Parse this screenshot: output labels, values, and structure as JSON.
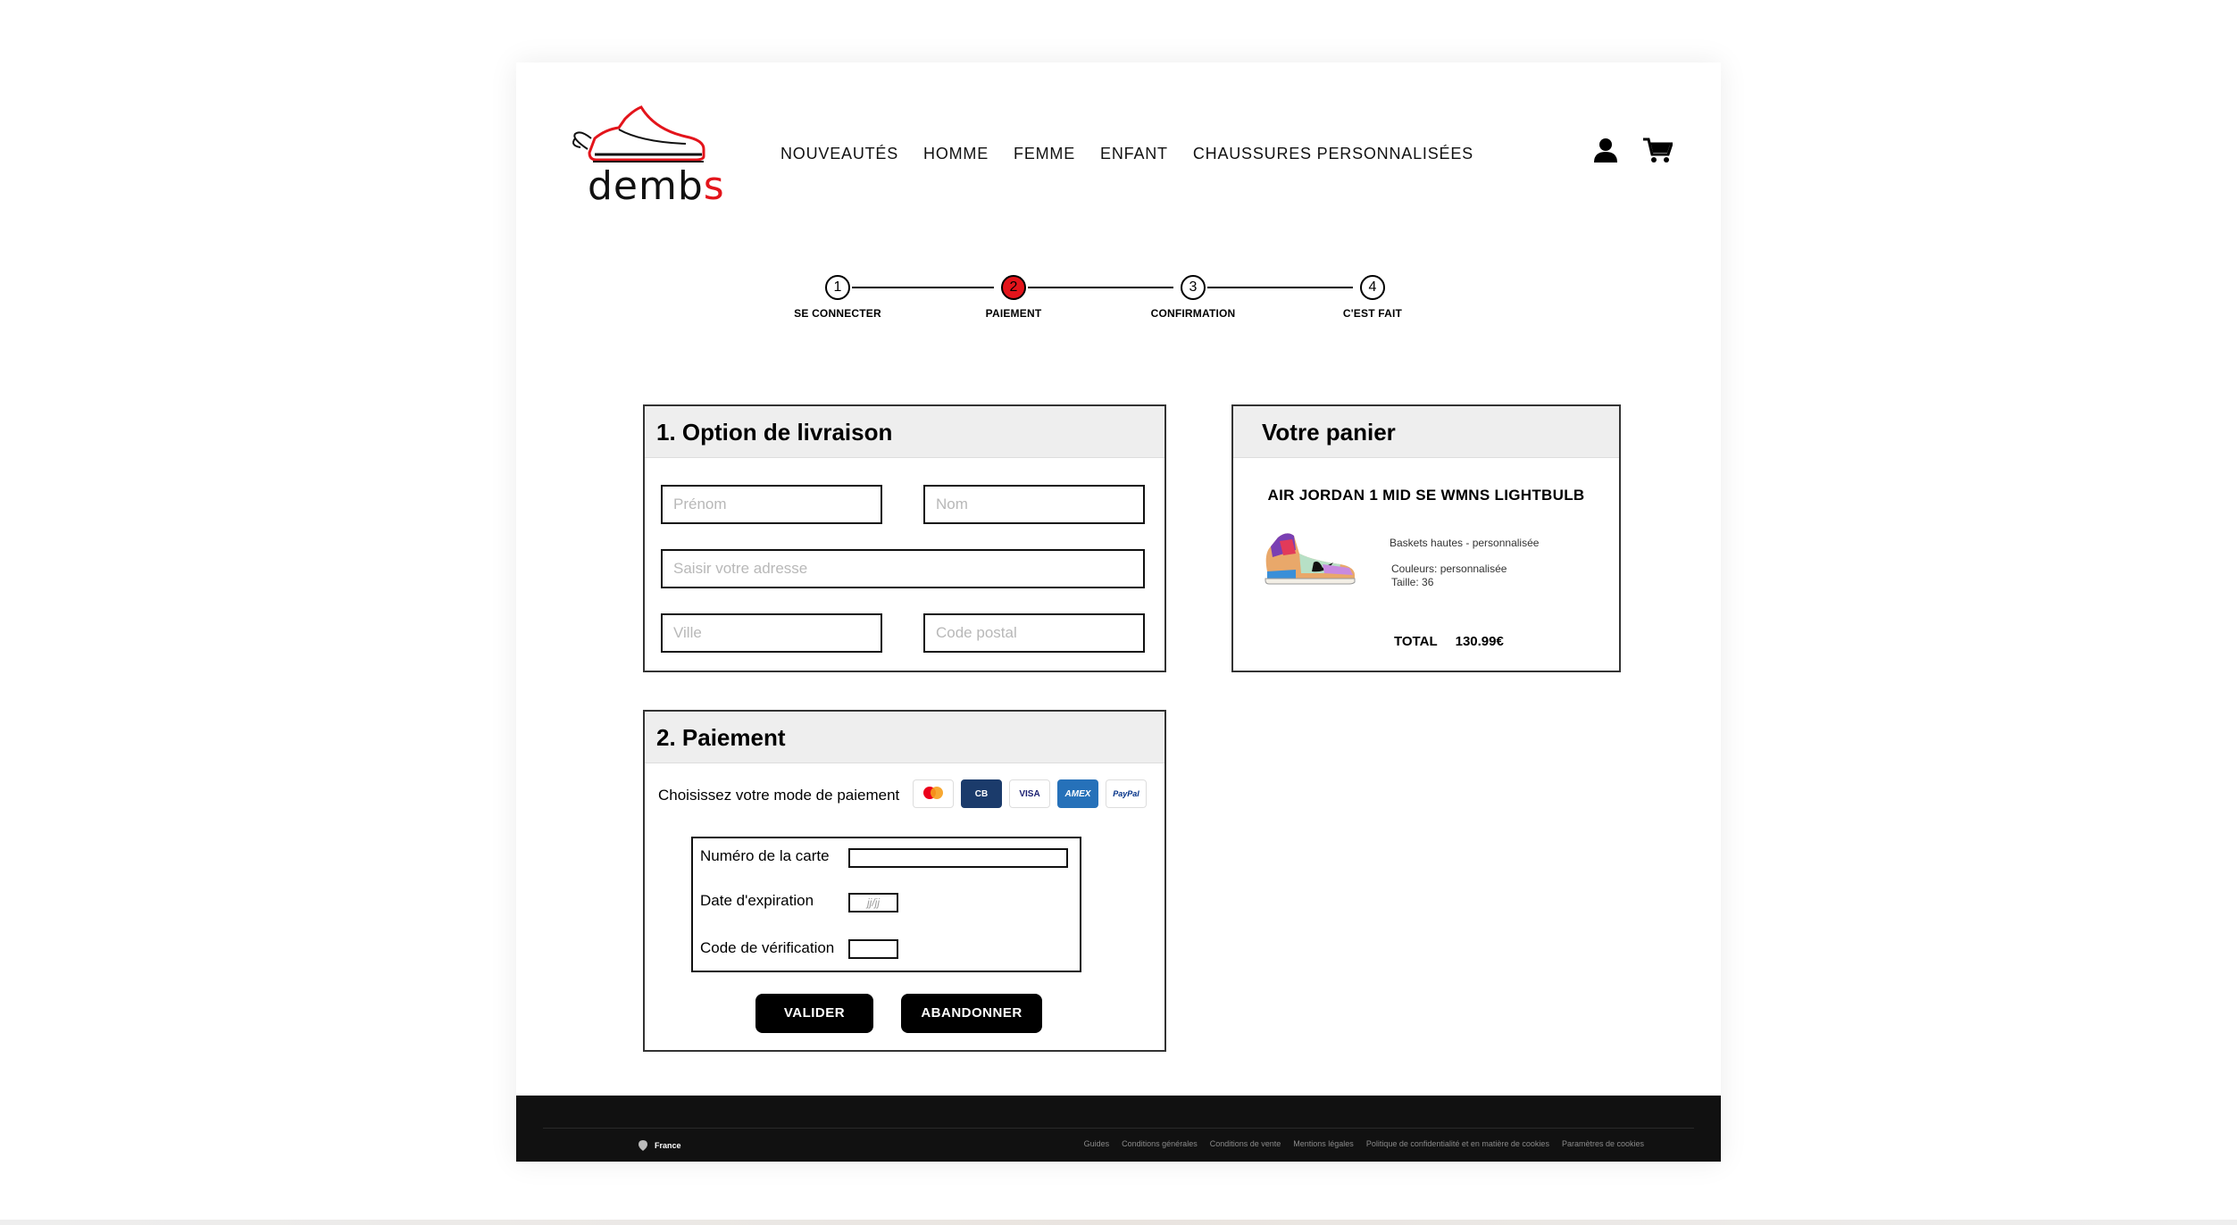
{
  "brand": {
    "logo_text_main": "demb",
    "logo_text_accent": "s"
  },
  "nav": {
    "items": [
      {
        "label": "NOUVEAUTÉS"
      },
      {
        "label": "HOMME"
      },
      {
        "label": "FEMME"
      },
      {
        "label": "ENFANT"
      },
      {
        "label": "CHAUSSURES PERSONNALISÉES"
      }
    ]
  },
  "header_icons": [
    "user-icon",
    "cart-icon"
  ],
  "stepper": {
    "steps": [
      {
        "number": "1",
        "label": "SE CONNECTER",
        "active": false
      },
      {
        "number": "2",
        "label": "PAIEMENT",
        "active": true
      },
      {
        "number": "3",
        "label": "CONFIRMATION",
        "active": false
      },
      {
        "number": "4",
        "label": "C'EST FAIT",
        "active": false
      }
    ]
  },
  "delivery": {
    "title": "1. Option de livraison",
    "first_name_placeholder": "Prénom",
    "last_name_placeholder": "Nom",
    "address_placeholder": "Saisir votre adresse",
    "city_placeholder": "Ville",
    "postal_code_placeholder": "Code postal"
  },
  "cart": {
    "title": "Votre panier",
    "product_name": "AIR JORDAN 1 MID SE WMNS LIGHTBULB",
    "description": "Baskets hautes - personnalisée",
    "colors": "Couleurs: personnalisée",
    "size": "Taille: 36",
    "total_label": "TOTAL",
    "total_value": "130.99€"
  },
  "payment": {
    "title": "2. Paiement",
    "choose_label": "Choisissez votre mode de paiement",
    "methods": [
      {
        "name": "mastercard-icon",
        "label": ""
      },
      {
        "name": "cb-icon",
        "label": "CB"
      },
      {
        "name": "visa-icon",
        "label": "VISA"
      },
      {
        "name": "amex-icon",
        "label": "AMEX"
      },
      {
        "name": "paypal-icon",
        "label": "PayPal"
      }
    ],
    "card_number_label": "Numéro de la carte",
    "expiry_label": "Date d'expiration",
    "expiry_placeholder": "jj/jj",
    "cvc_label": "Code de vérification",
    "validate_label": "VALIDER",
    "abandon_label": "ABANDONNER"
  },
  "footer": {
    "country": "France",
    "links": [
      "Guides",
      "Conditions générales",
      "Conditions de vente",
      "Mentions légales",
      "Politique de confidentialité et en matière de cookies",
      "Paramètres de cookies"
    ]
  },
  "colors": {
    "accent": "#e3141b",
    "footer_bg": "#111111",
    "panel_head_bg": "#eeeeee"
  }
}
